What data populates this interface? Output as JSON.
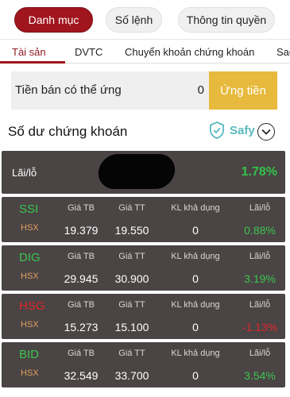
{
  "top_menu": [
    {
      "label": "Danh mục",
      "active": true
    },
    {
      "label": "Số lệnh",
      "active": false
    },
    {
      "label": "Thông tin quyền",
      "active": false
    }
  ],
  "tabs": [
    {
      "label": "Tài sản",
      "active": true
    },
    {
      "label": "DVTC",
      "active": false
    },
    {
      "label": "Chuyển khoản chứng khoán",
      "active": false
    },
    {
      "label": "Sao",
      "active": false
    }
  ],
  "advance": {
    "label": "Tiền bán có thể ứng",
    "value": "0",
    "button": "Ứng tiền"
  },
  "balance": {
    "title": "Số dư chứng khoán",
    "safy_label": "Safy"
  },
  "summary": {
    "label": "Lãi/lỗ",
    "value": "1.78%"
  },
  "column_headers": {
    "avg_price": "Giá TB",
    "market_price": "Giá TT",
    "available_qty": "KL khả dụng",
    "pnl": "Lãi/lỗ"
  },
  "holdings": [
    {
      "symbol": "SSI",
      "exchange": "HSX",
      "avg_price": "19.379",
      "market_price": "19.550",
      "available_qty": "0",
      "pnl": "0.88%",
      "trend": "up"
    },
    {
      "symbol": "DIG",
      "exchange": "HSX",
      "avg_price": "29.945",
      "market_price": "30.900",
      "available_qty": "0",
      "pnl": "3.19%",
      "trend": "up"
    },
    {
      "symbol": "HSG",
      "exchange": "HSX",
      "avg_price": "15.273",
      "market_price": "15.100",
      "available_qty": "0",
      "pnl": "-1.13%",
      "trend": "down"
    },
    {
      "symbol": "BID",
      "exchange": "HSX",
      "avg_price": "32.549",
      "market_price": "33.700",
      "available_qty": "0",
      "pnl": "3.54%",
      "trend": "up"
    }
  ],
  "colors": {
    "brand": "#a1151f",
    "advance_button": "#e7b93c",
    "card_bg": "#4a4444",
    "up": "#3bc54f",
    "down": "#e0262a",
    "safy": "#5bbac0"
  },
  "icons": [
    "shield-check-icon",
    "chevron-down-icon"
  ]
}
